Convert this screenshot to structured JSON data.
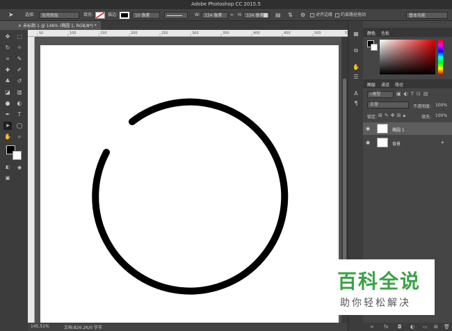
{
  "window": {
    "title": "Adobe Photoshop CC 2015.5"
  },
  "options": {
    "select_label": "选择:",
    "select_value": "现用图层",
    "fill_label": "填充:",
    "stroke_label": "描边:",
    "stroke_width": "10 像素",
    "w_label": "W:",
    "w_value": "334 像素",
    "h_label": "H:",
    "h_value": "334 像素",
    "align_edges": "对齐边缘",
    "constrain_path": "约束路径拖动",
    "workspace": "基本功能"
  },
  "document": {
    "tab_label": "未标题-1 @ 146% (椭圆 1, RGB/8*) *"
  },
  "rulers": {
    "top_ticks": [
      "50",
      "100",
      "150",
      "200",
      "250",
      "300",
      "350",
      "400",
      "450",
      "500",
      "550"
    ]
  },
  "status": {
    "zoom": "145.51%",
    "doc_info": "文档:826.2K/0 字节"
  },
  "panels": {
    "color_tabs": [
      "颜色",
      "色板"
    ],
    "layer_tabs": [
      "图层",
      "通道",
      "路径"
    ],
    "filter_kind": "类型",
    "blend_mode": "正常",
    "opacity_label": "不透明度:",
    "opacity_value": "100%",
    "lock_label": "锁定:",
    "fill_label": "填充:",
    "fill_value": "100%",
    "layers": [
      {
        "name": "椭圆 1"
      },
      {
        "name": "背景"
      }
    ]
  },
  "watermark": {
    "title": "百科全说",
    "subtitle": "助你轻松解决"
  },
  "colors": {
    "accent_green": "#3aa244",
    "panel_bg": "#454545",
    "canvas_bg": "#ffffff"
  },
  "icons": {
    "tools": [
      "move-icon",
      "marquee-icon",
      "lasso-icon",
      "magic-wand-icon",
      "crop-icon",
      "eyedropper-icon",
      "healing-brush-icon",
      "brush-icon",
      "clone-stamp-icon",
      "history-brush-icon",
      "eraser-icon",
      "gradient-icon",
      "blur-icon",
      "dodge-icon",
      "pen-icon",
      "type-icon",
      "path-select-icon",
      "ellipse-icon",
      "hand-icon",
      "zoom-icon",
      "more-tools-icon"
    ]
  }
}
